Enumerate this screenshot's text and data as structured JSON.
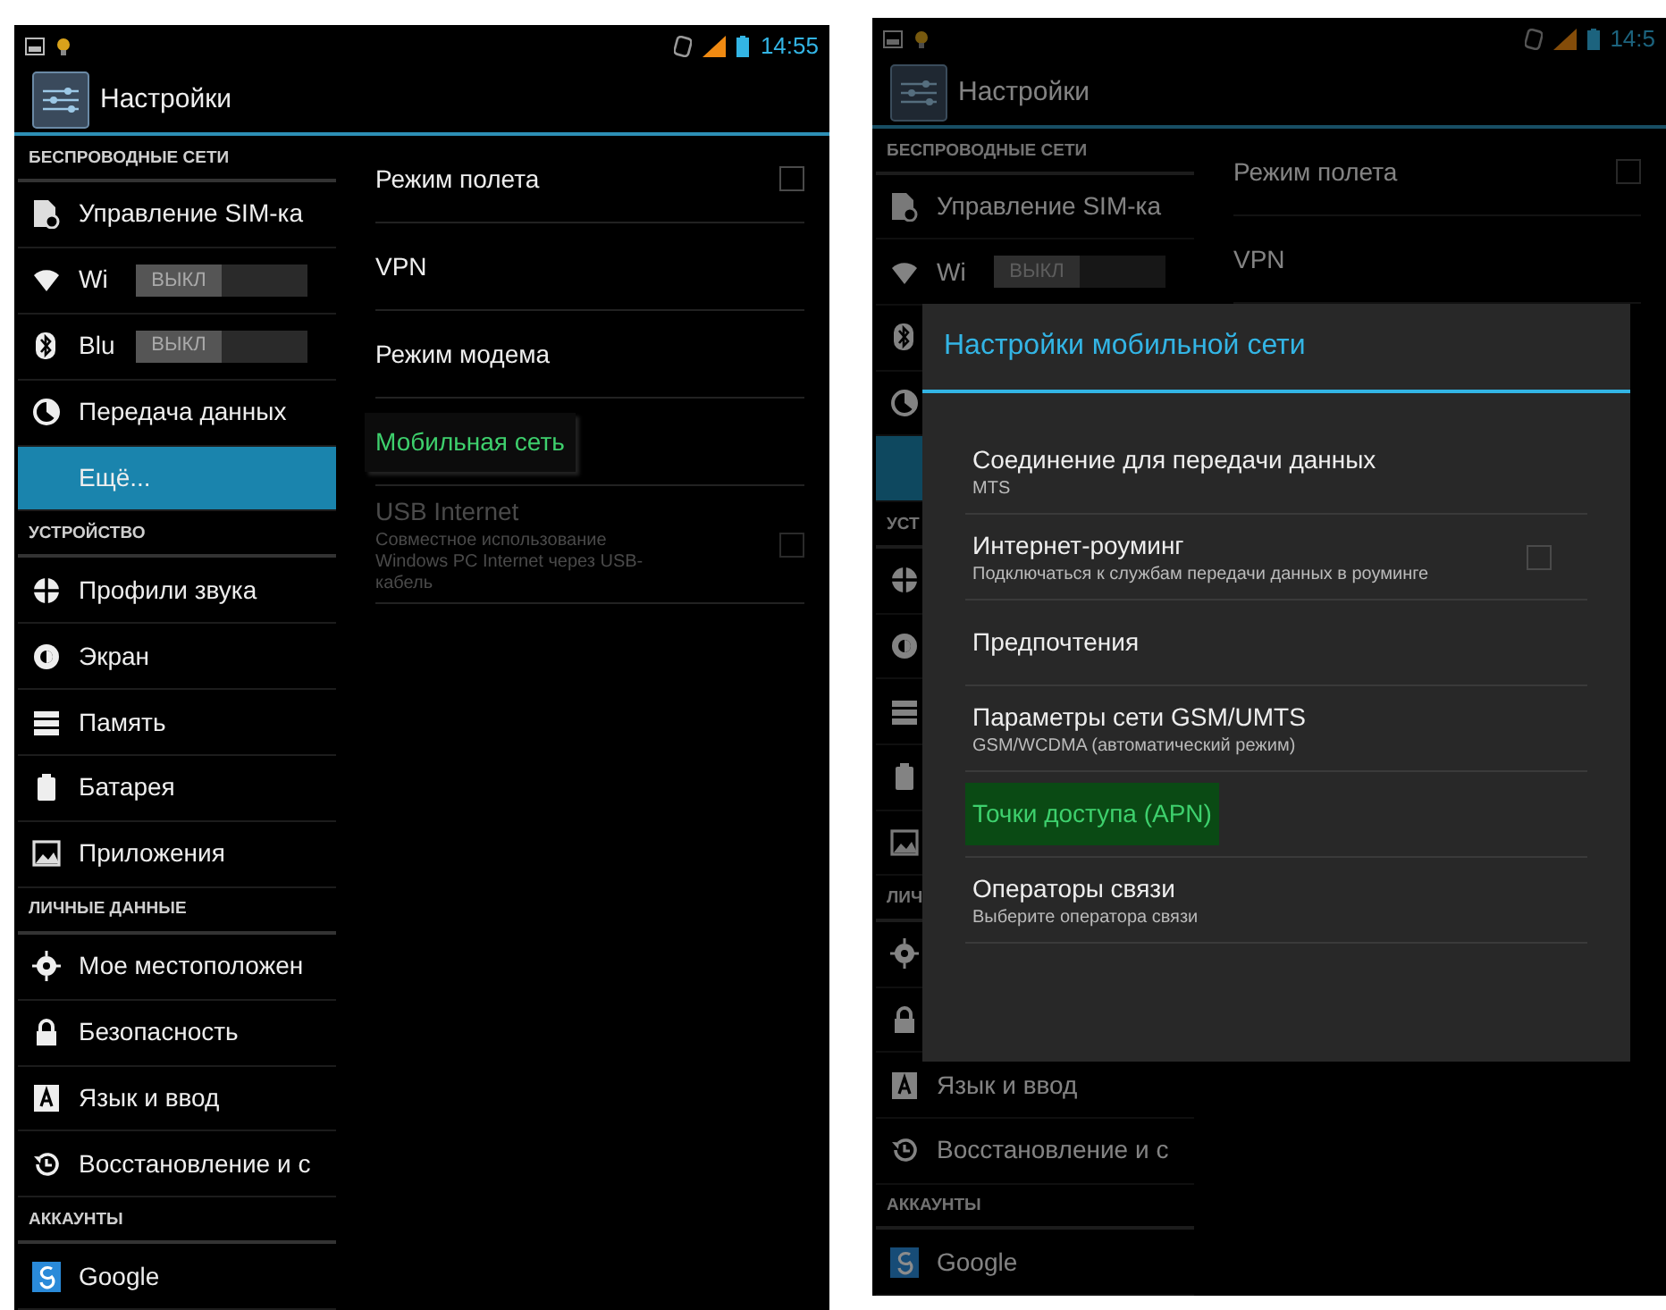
{
  "panels": [
    {
      "dimmed": false,
      "status_bar": {
        "time": "14:55"
      },
      "action_bar": {
        "title": "Настройки"
      },
      "sidebar": [
        {
          "kind": "header",
          "label": "БЕСПРОВОДНЫЕ СЕТИ"
        },
        {
          "kind": "item",
          "label": "Управление SIM-ка",
          "selected": false
        },
        {
          "kind": "toggle",
          "label": "Wi",
          "switch": {
            "label": "ВЫКЛ",
            "on": false
          },
          "selected": false
        },
        {
          "kind": "toggle",
          "label": "Blu",
          "switch": {
            "label": "ВЫКЛ",
            "on": false
          },
          "selected": false
        },
        {
          "kind": "item",
          "label": "Передача данных",
          "selected": false
        },
        {
          "kind": "item",
          "label": "Ещё...",
          "selected": true
        },
        {
          "kind": "header",
          "label": "УСТРОЙСТВО"
        },
        {
          "kind": "item",
          "label": "Профили звука",
          "selected": false
        },
        {
          "kind": "item",
          "label": "Экран",
          "selected": false
        },
        {
          "kind": "item",
          "label": "Память",
          "selected": false
        },
        {
          "kind": "item",
          "label": "Батарея",
          "selected": false
        },
        {
          "kind": "item",
          "label": "Приложения",
          "selected": false
        },
        {
          "kind": "header",
          "label": "ЛИЧНЫЕ ДАННЫЕ"
        },
        {
          "kind": "item",
          "label": "Мое местоположен",
          "selected": false
        },
        {
          "kind": "item",
          "label": "Безопасность",
          "selected": false
        },
        {
          "kind": "item",
          "label": "Язык и ввод",
          "selected": false
        },
        {
          "kind": "item",
          "label": "Восстановление и с",
          "selected": false
        },
        {
          "kind": "header",
          "label": "АККАУНТЫ"
        },
        {
          "kind": "item",
          "label": "Google",
          "selected": false
        }
      ],
      "content": [
        {
          "kind": "checkbox",
          "title": "Режим полета",
          "checked": false,
          "selected": false,
          "disabled": false
        },
        {
          "kind": "plain",
          "title": "VPN",
          "selected": false,
          "disabled": false
        },
        {
          "kind": "plain",
          "title": "Режим модема",
          "selected": false,
          "disabled": false
        },
        {
          "kind": "plain",
          "title": "Мобильная сеть",
          "selected": true,
          "disabled": false
        },
        {
          "kind": "checkbox",
          "title": "USB Internet",
          "summary": "Совместное использование Windows PC Internet через USB-кабель",
          "checked": false,
          "selected": false,
          "disabled": true
        }
      ]
    },
    {
      "dimmed": true,
      "status_bar": {
        "time": "14:5"
      },
      "action_bar": {
        "title": "Настройки"
      },
      "sidebar": [
        {
          "kind": "header",
          "label": "БЕСПРОВОДНЫЕ СЕТИ"
        },
        {
          "kind": "item",
          "label": "Управление SIM-ка",
          "selected": false
        },
        {
          "kind": "toggle",
          "label": "Wi",
          "switch": {
            "label": "ВЫКЛ",
            "on": false
          },
          "selected": false
        },
        {
          "kind": "toggle",
          "selected": false
        },
        {
          "kind": "item",
          "selected": false
        },
        {
          "kind": "item",
          "selected": true
        },
        {
          "kind": "header",
          "label": "УСТ"
        },
        {
          "kind": "item",
          "selected": false
        },
        {
          "kind": "item",
          "selected": false
        },
        {
          "kind": "item",
          "selected": false
        },
        {
          "kind": "item",
          "selected": false
        },
        {
          "kind": "item",
          "selected": false
        },
        {
          "kind": "header",
          "label": "ЛИЧ"
        },
        {
          "kind": "item",
          "selected": false
        },
        {
          "kind": "item",
          "selected": false
        },
        {
          "kind": "item",
          "label": "Язык и ввод",
          "selected": false
        },
        {
          "kind": "item",
          "label": "Восстановление и с",
          "selected": false
        },
        {
          "kind": "header",
          "label": "АККАУНТЫ"
        },
        {
          "kind": "item",
          "label": "Google",
          "selected": false
        }
      ],
      "content": [
        {
          "kind": "checkbox",
          "title": "Режим полета",
          "checked": false,
          "selected": false,
          "disabled": false
        },
        {
          "kind": "plain",
          "title": "VPN",
          "selected": false,
          "disabled": false
        }
      ],
      "dialog": {
        "title": "Настройки мобильной сети",
        "items": [
          {
            "kind": "plain",
            "title": "Соединение для передачи данных",
            "summary": "MTS",
            "selected": false
          },
          {
            "kind": "checkbox",
            "title": "Интернет-роуминг",
            "summary": "Подключаться к службам передачи данных в роуминге",
            "checked": false,
            "selected": false
          },
          {
            "kind": "plain",
            "title": "Предпочтения",
            "selected": false
          },
          {
            "kind": "plain",
            "title": "Параметры сети GSM/UMTS",
            "summary": "GSM/WCDMA (автоматический режим)",
            "selected": false
          },
          {
            "kind": "plain",
            "title": "Точки доступа (APN)",
            "selected": true
          },
          {
            "kind": "plain",
            "title": "Операторы связи",
            "summary": "Выберите оператора связи",
            "selected": false
          }
        ]
      }
    }
  ]
}
